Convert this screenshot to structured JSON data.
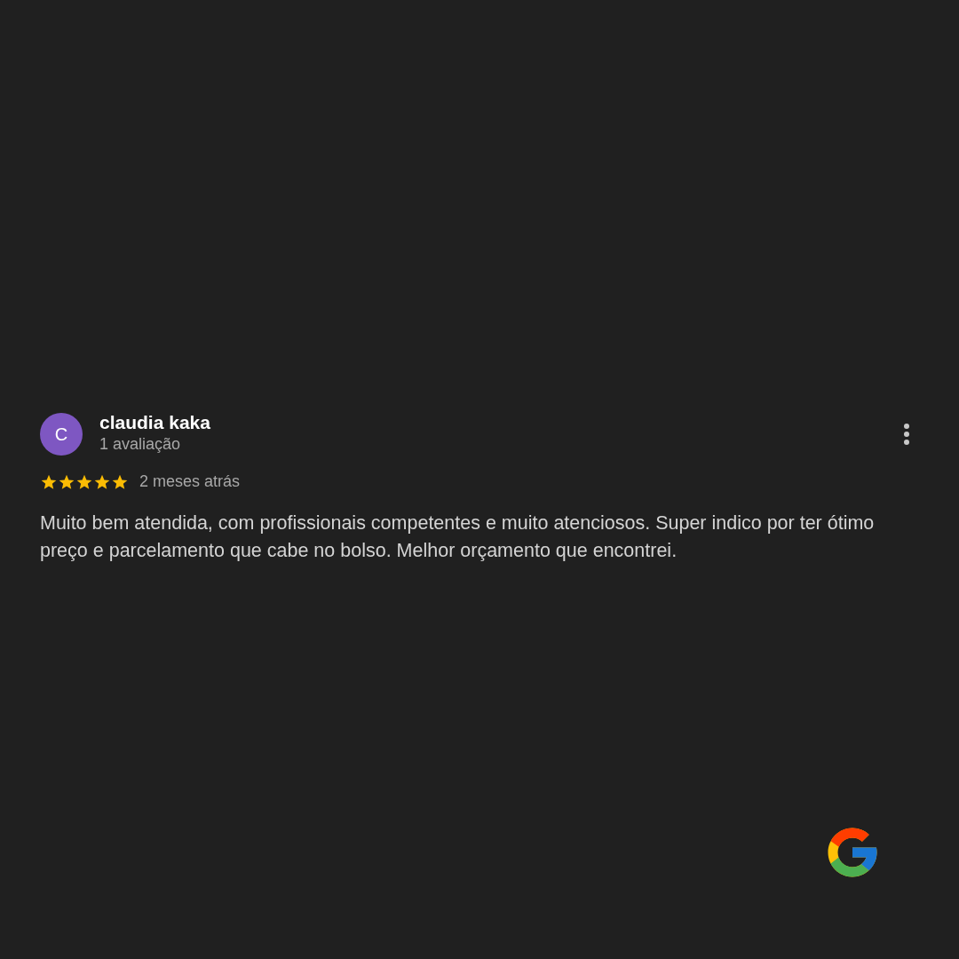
{
  "review": {
    "avatar_letter": "C",
    "color": "#7e57c2",
    "author": "claudia kaka",
    "author_reviews": "1 avaliação",
    "stars": 5,
    "time": "2 meses atrás",
    "text": "Muito bem atendida, com profissionais competentes e muito atenciosos. Super indico por ter ótimo preço e parcelamento que cabe no bolso. Melhor orçamento que encontrei."
  }
}
